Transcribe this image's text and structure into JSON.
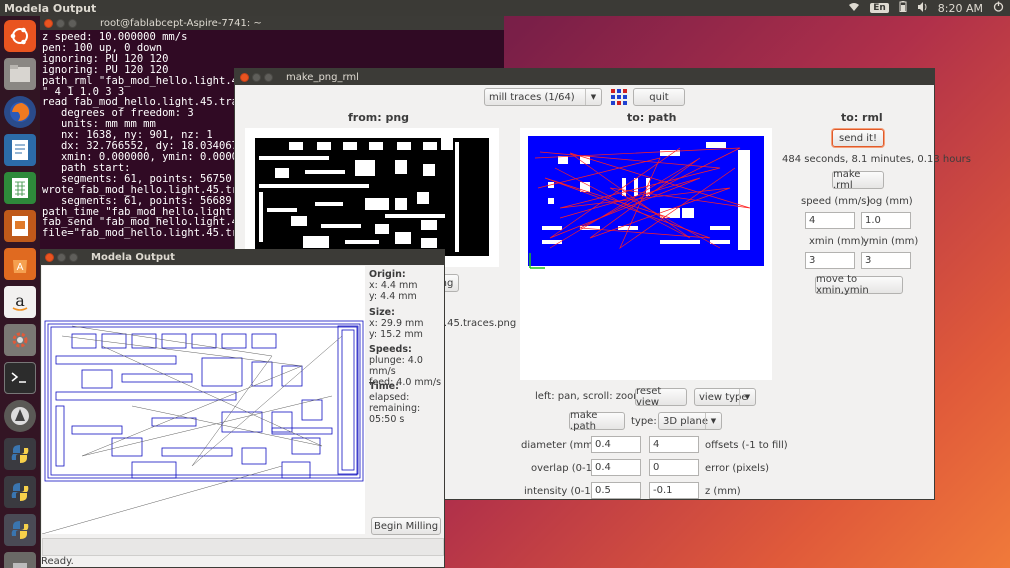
{
  "topbar": {
    "app_title": "Modela Output",
    "lang": "En",
    "time": "8:20 AM"
  },
  "launcher": {
    "icons": [
      "ubuntu-dash-icon",
      "files-icon",
      "firefox-icon",
      "writer-icon",
      "calc-icon",
      "impress-icon",
      "software-center-icon",
      "amazon-icon",
      "settings-icon",
      "terminal-icon",
      "update-icon",
      "python-icon",
      "python-icon",
      "python-icon",
      "trash-icon"
    ]
  },
  "terminal": {
    "title": "root@fablabcept-Aspire-7741: ~",
    "lines": [
      "z speed: 10.000000 mm/s",
      "pen: 100 up, 0 down",
      "ignoring: PU 120 120",
      "ignoring: PU 120 120",
      "path_rml \"fab_mod_hello.light.45.t",
      "\" 4 1 1.0 3 3",
      "read fab_mod_hello.light.45.traces",
      "   degrees of freedom: 3",
      "   units: mm mm mm",
      "   nx: 1638, ny: 901, nz: 1",
      "   dx: 32.766552, dy: 18.034067, i",
      "   xmin: 0.000000, ymin: 0.000000",
      "   path start:",
      "   segments: 61, points: 56750",
      "wrote fab_mod_hello.light.45.trace",
      "   segments: 61, points: 56689",
      "path_time \"fab_mod_hello.light.45.",
      "fab_send \"fab_mod_hello.light.45.t",
      "file=\"fab_mod_hello.light.45.trace"
    ]
  },
  "make_png_rml": {
    "title": "make_png_rml",
    "mode_select": "mill traces (1/64)",
    "quit_label": "quit",
    "col_png": "from: png",
    "col_path": "to: path",
    "col_rml": "to: rml",
    "send_label": "send it!",
    "time_estimate": "484 seconds, 8.1 minutes, 0.13 hours",
    "make_rml_label": "make .rml",
    "speed_label": "speed (mm/s)",
    "jog_label": "jog (mm)",
    "speed_value": "4",
    "jog_value": "1.0",
    "xmin_label": "xmin (mm)",
    "ymin_label": "ymin (mm)",
    "xmin_value": "3",
    "ymin_value": "3",
    "move_label": "move to xmin,ymin",
    "png_btn_partial": "ng",
    "png_filename_partial": "t.45.traces.png",
    "view_hint": "left: pan, scroll: zoom",
    "reset_view_label": "reset view",
    "view_type_label": "view type",
    "make_path_label": "make .path",
    "type_label": "type:",
    "type_value": "3D plane",
    "diameter_label": "diameter (mm)",
    "diameter_value": "0.4",
    "offsets_value": "4",
    "offsets_label": "offsets (-1 to fill)",
    "overlap_label": "overlap (0-1)",
    "overlap_value": "0.4",
    "error_value": "0",
    "error_label": "error (pixels)",
    "intensity_label": "intensity (0-1)",
    "intensity_value": "0.5",
    "z_value": "-0.1",
    "z_label": "z (mm)"
  },
  "modela": {
    "title": "Modela Output",
    "origin_h": "Origin:",
    "origin_x": "x: 4.4 mm",
    "origin_y": "y: 4.4 mm",
    "size_h": "Size:",
    "size_x": "x: 29.9 mm",
    "size_y": "y: 15.2 mm",
    "speeds_h": "Speeds:",
    "plunge": "plunge: 4.0 mm/s",
    "feed": "feed: 4.0 mm/s",
    "time_h": "Time:",
    "elapsed": "elapsed:",
    "remaining": "remaining: 05:50 s",
    "begin_label": "Begin Milling",
    "status": "Ready."
  },
  "colors": {
    "accent": "#e95420",
    "terminal_bg": "#300a24",
    "path_blue": "#0000ff",
    "path_red": "#ff2020"
  }
}
